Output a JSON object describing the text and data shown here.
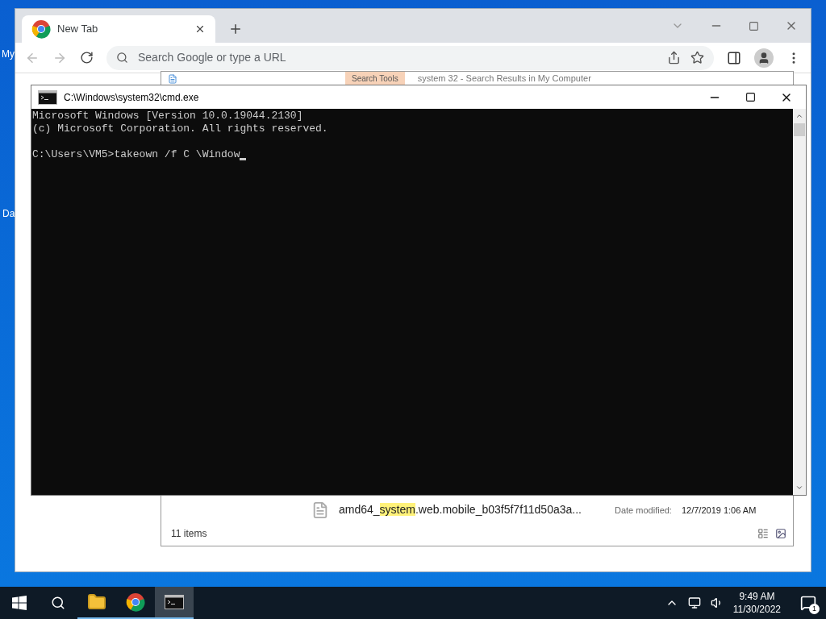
{
  "desktop_icons": [
    {
      "label": "My"
    },
    {
      "label": "Da"
    }
  ],
  "browser": {
    "tabs": [
      {
        "title": "New Tab",
        "selected": true
      }
    ],
    "address": {
      "placeholder": "Search Google or type a URL"
    }
  },
  "explorer": {
    "ribbon_tab": "Search Tools",
    "title": "system 32 - Search Results in My Computer",
    "results": [
      {
        "name_before": "amd64_",
        "match": "system",
        "name_after": ".web.mobile_b03f5f7f11d50a3a...",
        "date_label": "Date modified:",
        "date": "12/7/2019 1:06 AM"
      }
    ],
    "status": "11 items"
  },
  "console": {
    "title": "C:\\Windows\\system32\\cmd.exe",
    "banner": [
      "Microsoft Windows [Version 10.0.19044.2130]",
      "(c) Microsoft Corporation. All rights reserved."
    ],
    "prompt": "C:\\Users\\VM5>takeown /f C \\Window"
  },
  "taskbar": {
    "apps": [
      {
        "kind": "files",
        "active": false
      },
      {
        "kind": "browser",
        "active": false
      },
      {
        "kind": "console",
        "active": true
      }
    ],
    "time": "9:49 AM",
    "date": "11/30/2022",
    "notifications": "1"
  }
}
